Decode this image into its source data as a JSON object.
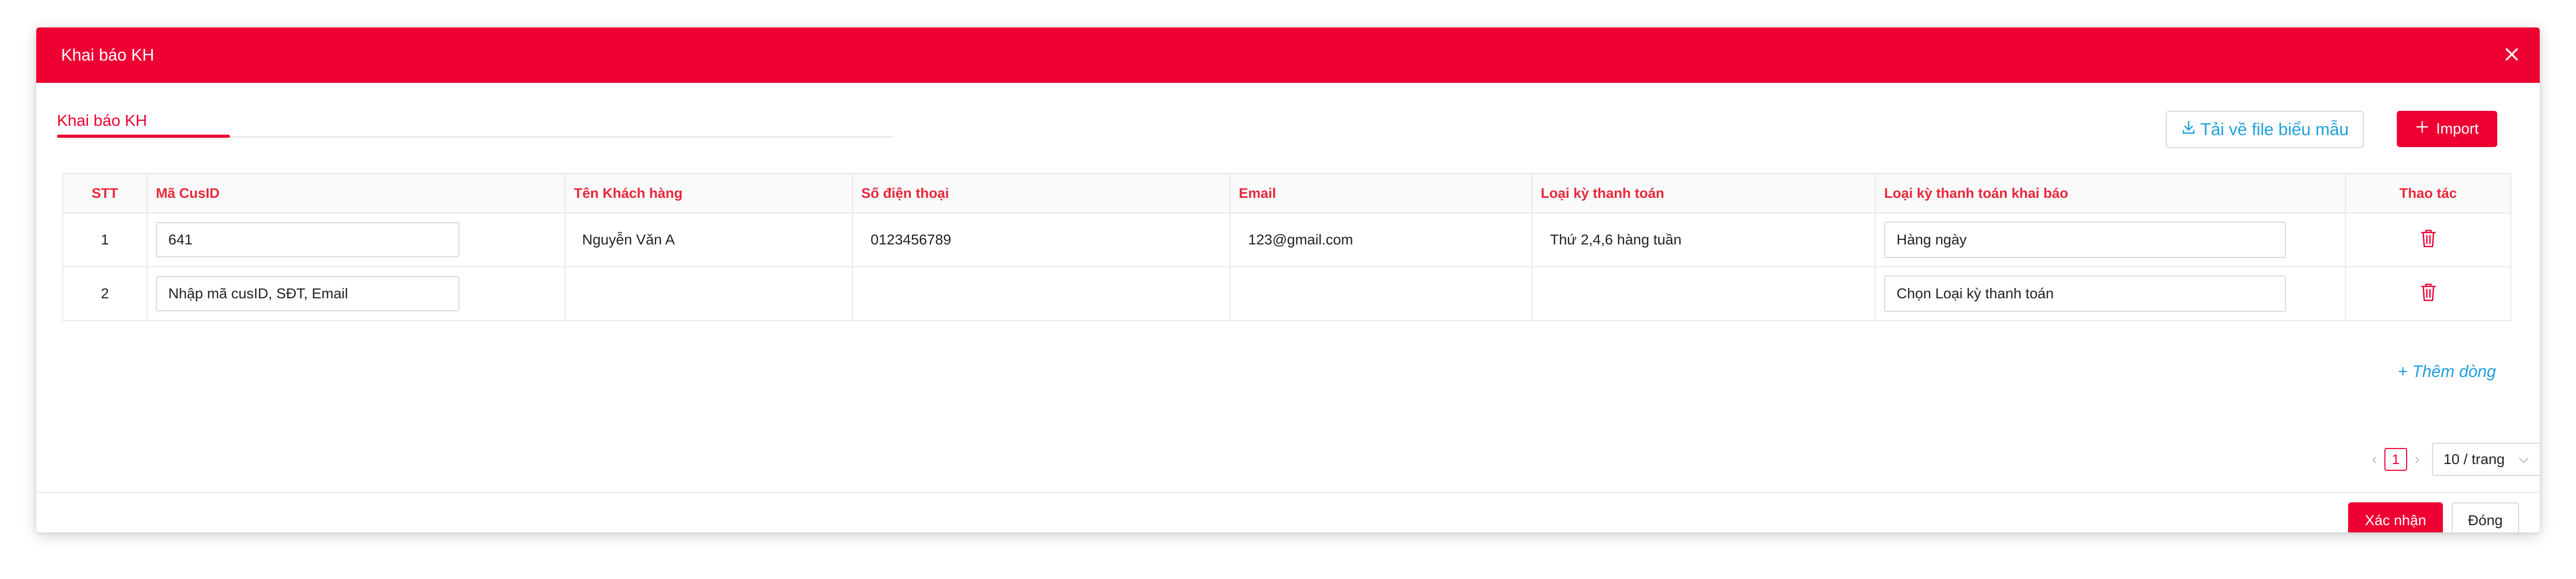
{
  "modal": {
    "title": "Khai báo KH",
    "close_icon": "close-icon"
  },
  "tabs": [
    {
      "label": "Khai báo KH",
      "active": true
    }
  ],
  "toolbar": {
    "template_label": "Tải về file biểu mẫu",
    "template_icon": "download-icon",
    "import_label": "Import",
    "import_icon": "plus-icon"
  },
  "table": {
    "columns": [
      "STT",
      "Mã CusID",
      "Tên Khách hàng",
      "Số điện thoại",
      "Email",
      "Loại kỳ thanh toán",
      "Loại kỳ thanh toán khai báo",
      "Thao tác"
    ],
    "rows": [
      {
        "stt": "1",
        "cusid_value": "641",
        "cusid_placeholder": "",
        "name": "Nguyễn Văn A",
        "phone": "0123456789",
        "email": "123@gmail.com",
        "payment_period": "Thứ 2,4,6 hàng tuần",
        "declared_period": "Hàng ngày",
        "action_icon": "trash-icon"
      },
      {
        "stt": "2",
        "cusid_value": "",
        "cusid_placeholder": "Nhập mã cusID, SĐT, Email",
        "name": "",
        "phone": "",
        "email": "",
        "payment_period": "",
        "declared_period": "Chọn Loại kỳ thanh toán",
        "action_icon": "trash-icon"
      }
    ]
  },
  "add_row_label": "+ Thêm dòng",
  "pagination": {
    "prev": "‹",
    "current_page": "1",
    "next": "›",
    "page_size": "10 / trang"
  },
  "footer": {
    "confirm_label": "Xác nhận",
    "close_label": "Đóng"
  },
  "colors": {
    "brand": "#ee0033",
    "link": "#1fa0dc"
  }
}
